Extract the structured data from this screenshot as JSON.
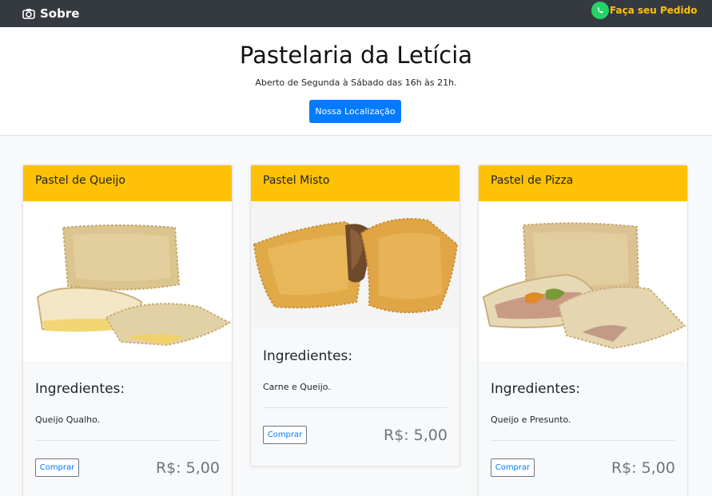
{
  "nav": {
    "brand_label": "Sobre",
    "order_label": "Faça seu Pedido"
  },
  "hero": {
    "title": "Pastelaria da Letícia",
    "hours": "Aberto de Segunda à Sábado das 16h às 21h.",
    "location_button": "Nossa Localização"
  },
  "ingredients_heading": "Ingredientes:",
  "buy_label": "Comprar",
  "products": [
    {
      "name": "Pastel de Queijo",
      "ingredients": "Queijo Qualho.",
      "price": "R$: 5,00"
    },
    {
      "name": "Pastel Misto",
      "ingredients": "Carne e Queijo.",
      "price": "R$: 5,00"
    },
    {
      "name": "Pastel de Pizza",
      "ingredients": "Queijo e Presunto.",
      "price": "R$: 5,00"
    }
  ],
  "colors": {
    "navbar": "#343a40",
    "accent": "#ffc107",
    "primary": "#007bff",
    "price": "#6c757d"
  }
}
